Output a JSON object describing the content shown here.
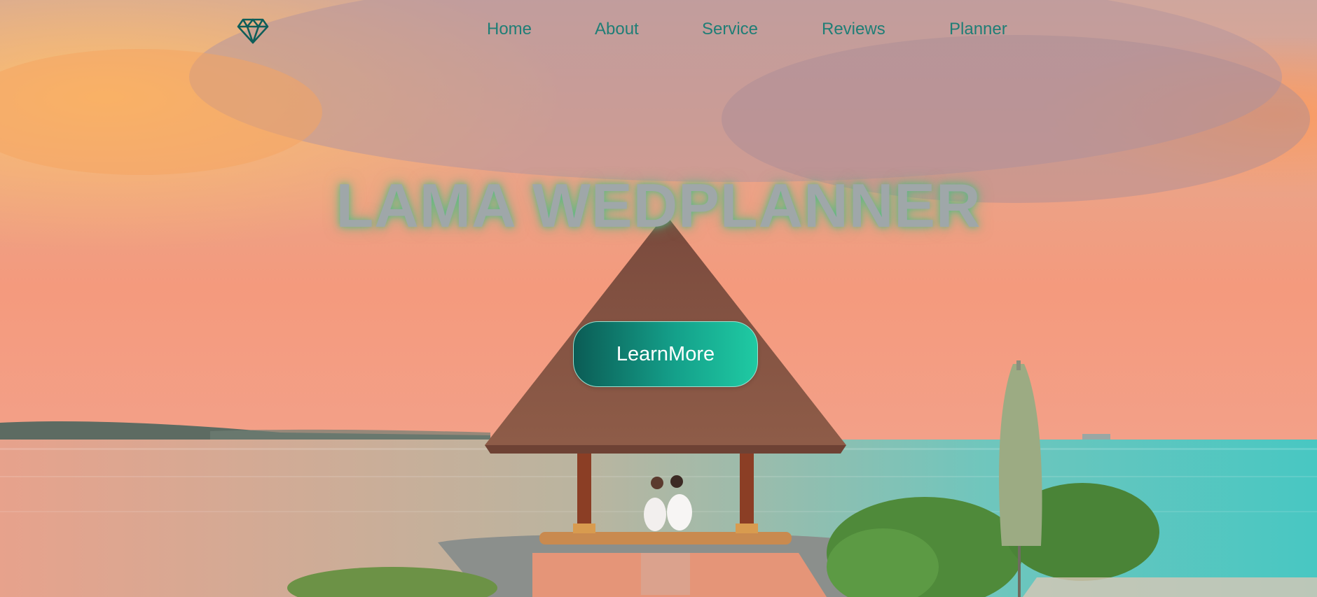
{
  "brand": {
    "logo_icon": "diamond-icon",
    "logo_color": "#0e5e59"
  },
  "nav": {
    "links": [
      {
        "label": "Home"
      },
      {
        "label": "About"
      },
      {
        "label": "Service"
      },
      {
        "label": "Reviews"
      },
      {
        "label": "Planner"
      }
    ],
    "link_color": "#1f7e76"
  },
  "hero": {
    "title": "LAMA WEDPLANNER",
    "cta_label": "LearnMore",
    "accent_gradient": [
      "#0b5c55",
      "#1fcaa3"
    ]
  }
}
